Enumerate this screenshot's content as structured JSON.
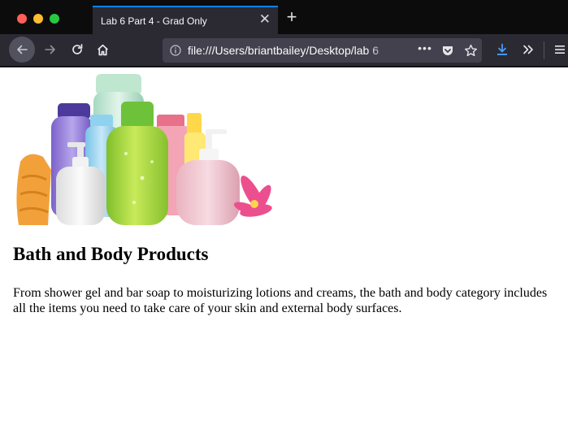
{
  "window": {
    "tab_title": "Lab 6 Part 4 - Grad Only",
    "tab_close_glyph": "✕",
    "new_tab_glyph": "+"
  },
  "toolbar": {
    "url": "file:///Users/briantbailey/Desktop/lab 6",
    "more_glyph": "•••",
    "icons": [
      "back-arrow-icon",
      "forward-arrow-icon",
      "reload-icon",
      "home-icon",
      "info-icon",
      "pocket-icon",
      "star-icon",
      "download-icon",
      "overflow-chevron-icon",
      "hamburger-menu-icon"
    ],
    "accent_color": "#0a84ff"
  },
  "page": {
    "hero_image": "bath-products-bottles-image",
    "heading": "Bath and Body Products",
    "paragraph": "From shower gel and bar soap to moisturizing lotions and creams, the bath and body category includes all the items you need to take care of your skin and external body surfaces."
  }
}
